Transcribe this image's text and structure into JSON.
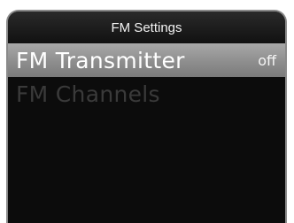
{
  "header": {
    "title": "FM Settings"
  },
  "menu": {
    "items": [
      {
        "label": "FM Transmitter",
        "value": "off",
        "state": "selected"
      },
      {
        "label": "FM Channels",
        "value": "",
        "state": "disabled"
      }
    ]
  },
  "colors": {
    "background": "#0c0c0c",
    "selection": "#929292",
    "disabled_text": "#3a3a3a",
    "frame": "#8a8a8a"
  }
}
